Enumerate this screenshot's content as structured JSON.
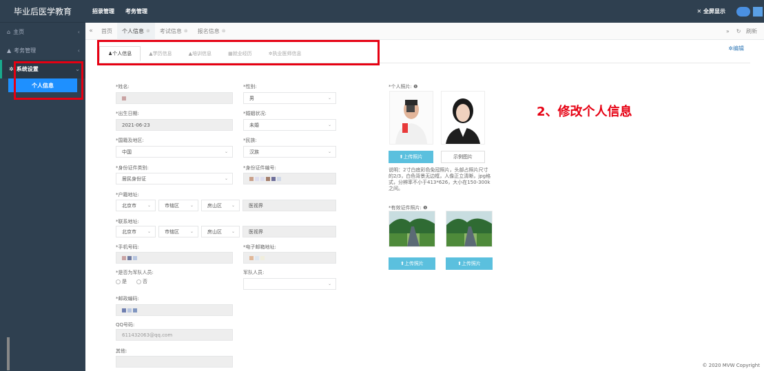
{
  "sidebar": {
    "brand": "毕业后医学教育",
    "items": [
      {
        "icon": "home-icon",
        "label": "主页"
      },
      {
        "icon": "graduation-cap-icon",
        "label": "考务管理"
      },
      {
        "icon": "gears-icon",
        "label": "系统设置"
      }
    ],
    "sub_items": [
      {
        "label": "个人信息"
      }
    ]
  },
  "topbar": {
    "menus": [
      "招录管理",
      "考务管理"
    ],
    "fullscreen": "全屏显示"
  },
  "tabs": {
    "items": [
      {
        "label": "首页",
        "closable": false
      },
      {
        "label": "个人信息",
        "closable": true
      },
      {
        "label": "考试信息",
        "closable": true
      },
      {
        "label": "报名信息",
        "closable": true
      }
    ],
    "refresh": "刷新"
  },
  "subtabs": [
    "个人信息",
    "学历信息",
    "培训信息",
    "就业经历",
    "执业医师信息"
  ],
  "edit_label": "编辑",
  "form": {
    "name_label": "*姓名:",
    "gender_label": "*性别:",
    "gender_value": "男",
    "birth_label": "*出生日期:",
    "birth_value": "2021-06-23",
    "marital_label": "*婚姻状况:",
    "marital_value": "未婚",
    "country_label": "*国籍及地区:",
    "country_value": "中国",
    "ethnicity_label": "*民族:",
    "ethnicity_value": "汉族",
    "id_type_label": "*身份证件类别:",
    "id_type_value": "居民身份证",
    "id_no_label": "*身份证件编号:",
    "hukou_label": "*户籍地址:",
    "hukou_city": "北京市",
    "hukou_district1": "市辖区",
    "hukou_district2": "房山区",
    "hukou_detail": "医视界",
    "contact_label": "*联系地址:",
    "contact_city": "北京市",
    "contact_district1": "市辖区",
    "contact_district2": "房山区",
    "contact_detail": "医视界",
    "phone_label": "*手机号码:",
    "email_label": "*电子邮箱地址:",
    "military_label": "*是否为军队人员:",
    "military_yes": "是",
    "military_no": "否",
    "military_type_label": "军队人员:",
    "postal_label": "*邮政编码:",
    "qq_label": "QQ号码:",
    "qq_value": "611432063@qq.com",
    "other_label": "其他:"
  },
  "photos": {
    "personal_label": "*个人照片:",
    "upload_label": "上传照片",
    "example_label": "示例图片",
    "note": "说明：2寸白底彩色免冠照片，头部占照片尺寸的2/3，白色背景无边框，人像正立清晰，jpg格式，分辨率不小于413*626，大小在150-300k之间。",
    "id_label": "*有效证件照片:",
    "upload_label_2": "上传照片",
    "upload_label_3": "上传照片"
  },
  "instruction": "2、修改个人信息",
  "footer": "© 2020 MVW Copyright",
  "colors": {
    "sidebar": "#2f4050",
    "accent": "#1e90ff",
    "highlight": "#e60012",
    "upload": "#5bc0de"
  }
}
